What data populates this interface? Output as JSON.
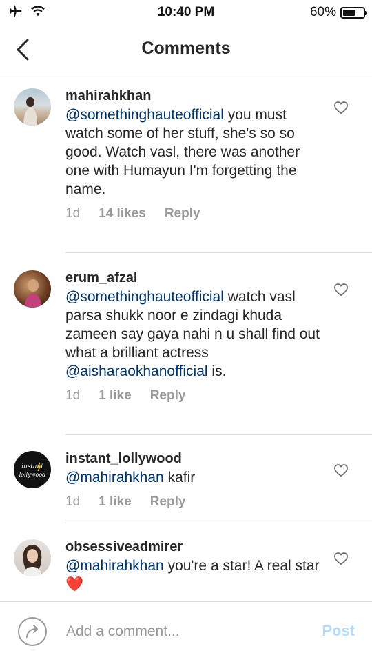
{
  "status_bar": {
    "time": "10:40 PM",
    "battery": "60%",
    "battery_level": 0.6,
    "icons": [
      "airplane-icon",
      "wifi-icon",
      "battery-icon"
    ]
  },
  "nav": {
    "title": "Comments",
    "back_icon": "chevron-left-icon"
  },
  "comments": [
    {
      "username": "mahirahkhan",
      "mention": "@somethinghauteofficial",
      "text": " you must watch some of her stuff, she's so so good. Watch vasl, there was another one with Humayun I'm forgetting the name.",
      "time": "1d",
      "likes": "14 likes",
      "reply": "Reply"
    },
    {
      "username": "erum_afzal",
      "mention": "@somethinghauteofficial",
      "text_a": "  watch vasl parsa shukk noor e zindagi khuda zameen say gaya nahi n u shall find out what a brilliant actress ",
      "mention2": "@aisharaokhanofficial",
      "text_b": " is.",
      "time": "1d",
      "likes": "1 like",
      "reply": "Reply"
    },
    {
      "username": "instant_lollywood",
      "avatar_text_1": "instant",
      "avatar_text_2": "lollywood",
      "mention": "@mahirahkhan",
      "text": " kafir",
      "time": "1d",
      "likes": "1 like",
      "reply": "Reply"
    },
    {
      "username": "obsessiveadmirer",
      "mention": "@mahirahkhan",
      "text": " you're a star! A real star",
      "emoji": "❤️"
    }
  ],
  "composer": {
    "placeholder": "Add a comment...",
    "post_label": "Post"
  },
  "colors": {
    "mention": "#003569",
    "meta": "#999999",
    "post_disabled": "#b3dbff",
    "divider": "#dbdbdb"
  }
}
